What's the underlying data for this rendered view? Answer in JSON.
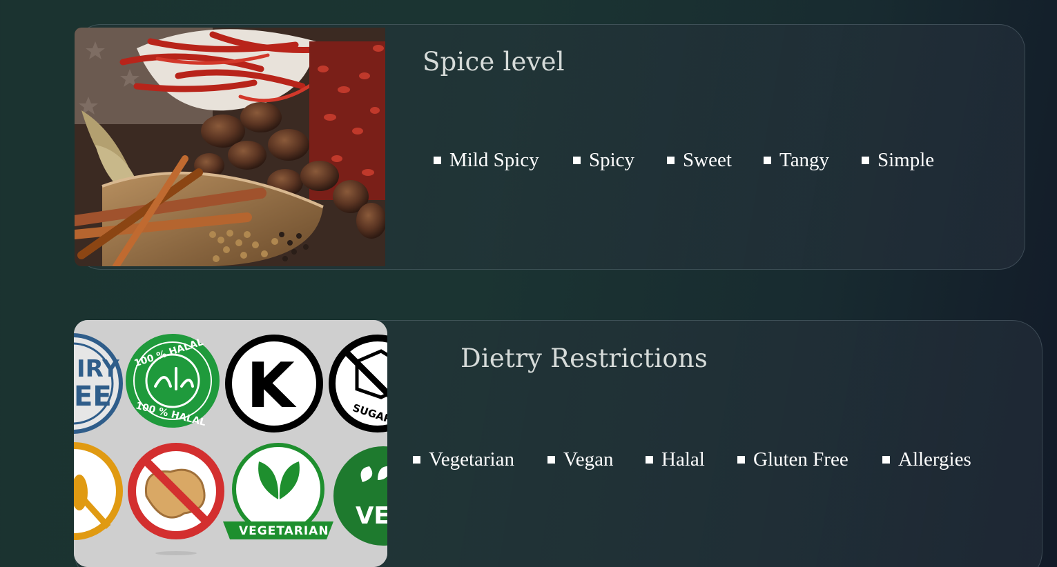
{
  "sections": [
    {
      "title": "Spice level",
      "image": "spices-photo",
      "options": [
        "Mild Spicy",
        "Spicy",
        "Sweet",
        "Tangy",
        "Simple"
      ]
    },
    {
      "title": "Dietry Restrictions",
      "image": "dietary-badges-photo",
      "options": [
        "Vegetarian",
        "Vegan",
        "Halal",
        "Gluten Free",
        "Allergies"
      ]
    }
  ],
  "badges": {
    "halal_top": "100 % HALAL",
    "halal_bottom": "100 % HALAL",
    "kosher": "K",
    "sugar": "SUGAR",
    "dairy_free_top": "IRY",
    "dairy_free_bottom": "EE",
    "vegetarian": "VEGETARIAN",
    "vegan": "VEG"
  },
  "colors": {
    "background": "#1b3432",
    "title": "#d6dbd9",
    "option_text": "#ffffff",
    "halal_green": "#1f9a3c",
    "no_peanut_red": "#d32f2f",
    "vegetarian_green": "#1e8f2e"
  }
}
